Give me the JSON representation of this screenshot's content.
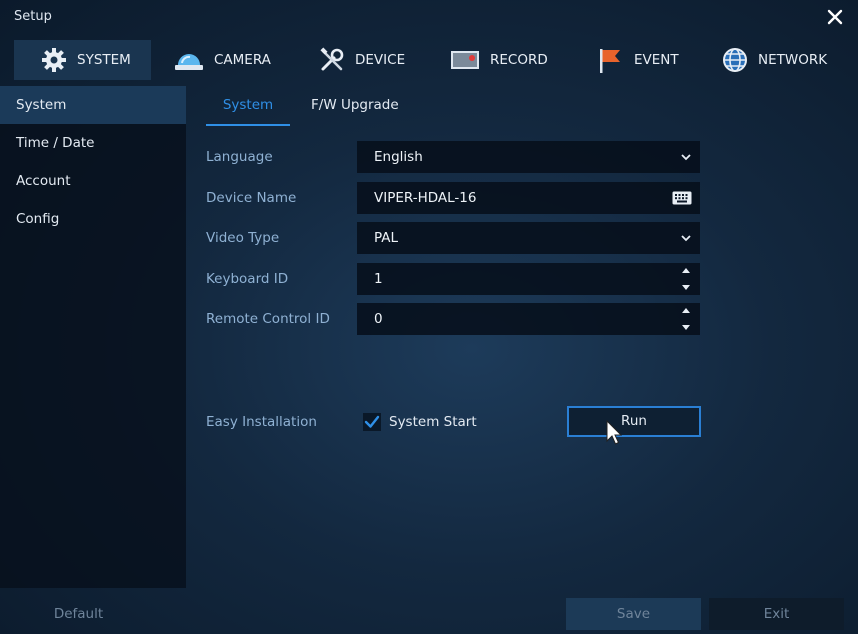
{
  "window": {
    "title": "Setup"
  },
  "tabs": [
    {
      "label": "SYSTEM",
      "icon": "gear-icon"
    },
    {
      "label": "CAMERA",
      "icon": "camera-icon"
    },
    {
      "label": "DEVICE",
      "icon": "tools-icon"
    },
    {
      "label": "RECORD",
      "icon": "record-icon"
    },
    {
      "label": "EVENT",
      "icon": "flag-icon"
    },
    {
      "label": "NETWORK",
      "icon": "globe-icon"
    }
  ],
  "sidebar": {
    "items": [
      {
        "label": "System"
      },
      {
        "label": "Time / Date"
      },
      {
        "label": "Account"
      },
      {
        "label": "Config"
      }
    ]
  },
  "subtabs": [
    {
      "label": "System"
    },
    {
      "label": "F/W Upgrade"
    }
  ],
  "form": {
    "language": {
      "label": "Language",
      "value": "English"
    },
    "device_name": {
      "label": "Device Name",
      "value": "VIPER-HDAL-16"
    },
    "video_type": {
      "label": "Video Type",
      "value": "PAL"
    },
    "keyboard_id": {
      "label": "Keyboard ID",
      "value": "1"
    },
    "remote_control_id": {
      "label": "Remote Control ID",
      "value": "0"
    },
    "easy_installation": {
      "label": "Easy Installation",
      "checkbox_label": "System Start",
      "checked": true,
      "button_label": "Run"
    }
  },
  "footer": {
    "default_label": "Default",
    "save_label": "Save",
    "exit_label": "Exit"
  },
  "colors": {
    "accent": "#2f8fe6",
    "sidebar_active": "#1b3a59",
    "label": "#8fb1d3"
  }
}
